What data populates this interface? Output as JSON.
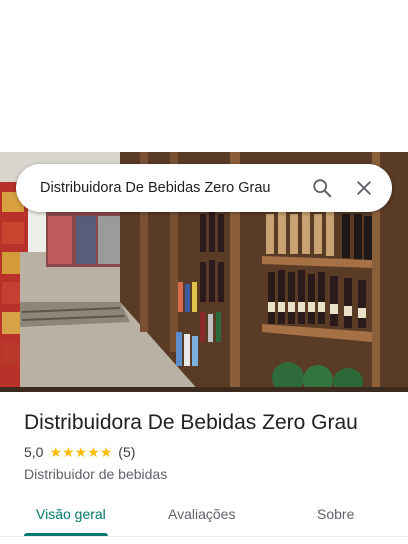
{
  "search": {
    "value": "Distribuidora De Bebidas Zero Grau",
    "search_icon": "search-icon",
    "close_icon": "close-icon"
  },
  "photo": {
    "description_icon": "store-photo"
  },
  "place": {
    "name": "Distribuidora De Bebidas Zero Grau",
    "rating": "5,0",
    "stars": 5,
    "review_count": "(5)",
    "category": "Distribuidor de bebidas"
  },
  "tabs": [
    {
      "label": "Visão geral",
      "active": true
    },
    {
      "label": "Avaliações",
      "active": false
    },
    {
      "label": "Sobre",
      "active": false
    }
  ],
  "colors": {
    "accent": "#00796b",
    "star": "#fbbc04"
  }
}
